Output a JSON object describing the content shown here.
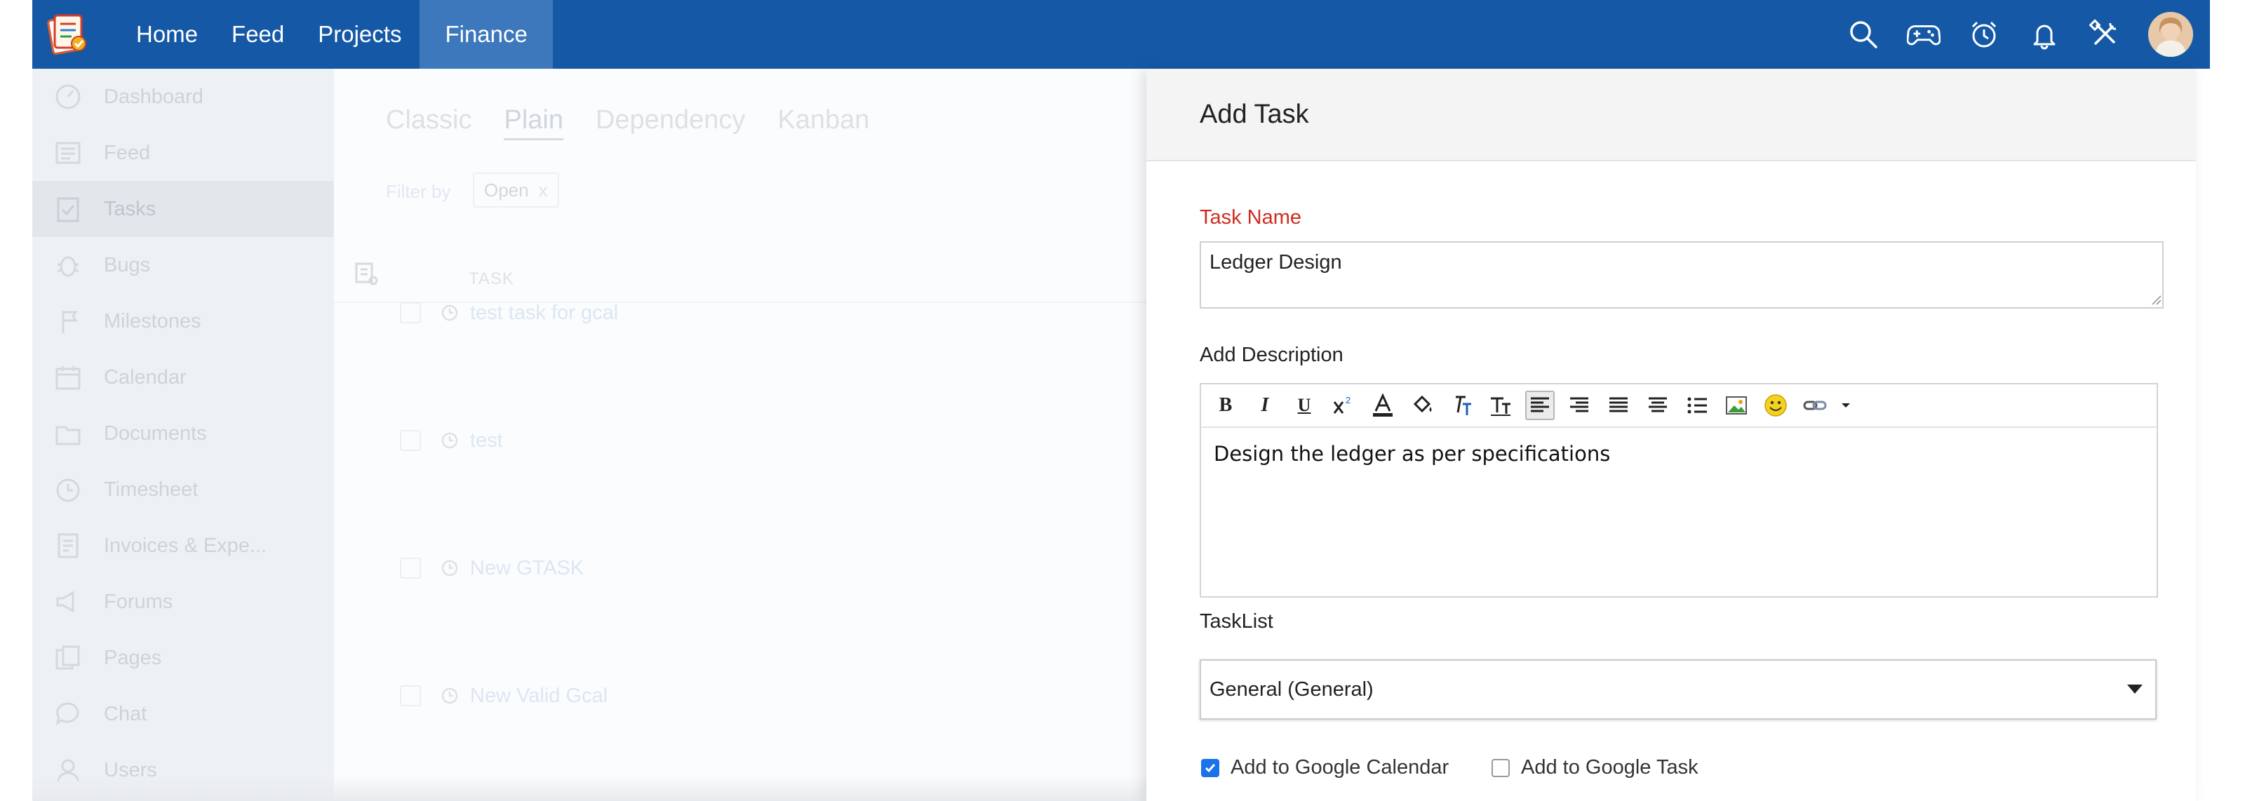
{
  "topbar": {
    "nav": [
      "Home",
      "Feed",
      "Projects",
      "Finance"
    ],
    "active_nav": "Finance",
    "icons": [
      "search-icon",
      "gamepad-icon",
      "timer-icon",
      "bell-icon",
      "tools-icon"
    ],
    "bar_color": "#1559a6",
    "active_color": "#3c78bb"
  },
  "sidebar": {
    "items": [
      {
        "label": "Dashboard",
        "icon": "dashboard-icon"
      },
      {
        "label": "Feed",
        "icon": "feed-icon"
      },
      {
        "label": "Tasks",
        "icon": "tasks-icon"
      },
      {
        "label": "Bugs",
        "icon": "bug-icon"
      },
      {
        "label": "Milestones",
        "icon": "milestone-icon"
      },
      {
        "label": "Calendar",
        "icon": "calendar-icon"
      },
      {
        "label": "Documents",
        "icon": "documents-icon"
      },
      {
        "label": "Timesheet",
        "icon": "timesheet-icon"
      },
      {
        "label": "Invoices & Expe...",
        "icon": "invoice-icon"
      },
      {
        "label": "Forums",
        "icon": "forum-icon"
      },
      {
        "label": "Pages",
        "icon": "pages-icon"
      },
      {
        "label": "Chat",
        "icon": "chat-icon"
      },
      {
        "label": "Users",
        "icon": "users-icon"
      }
    ],
    "active": "Tasks"
  },
  "content": {
    "view_tabs": [
      "Classic",
      "Plain",
      "Dependency",
      "Kanban"
    ],
    "active_tab": "Plain",
    "filter_label": "Filter by",
    "filter_value": "Open",
    "filter_remove": "x",
    "column_header": "TASK",
    "tasks": [
      "test task for gcal",
      "test",
      "New GTASK",
      "New Valid Gcal"
    ]
  },
  "panel": {
    "title": "Add Task",
    "task_name_label": "Task Name",
    "task_name_value": "Ledger Design",
    "description_label": "Add Description",
    "description_value": "Design the ledger as per specifications",
    "tasklist_label": "TaskList",
    "tasklist_value": "General (General)",
    "google_calendar_label": "Add to Google Calendar",
    "google_calendar_checked": true,
    "google_task_label": "Add to Google Task",
    "google_task_checked": false,
    "required_color": "#cf2c1f",
    "checkbox_color": "#1a73e8"
  }
}
